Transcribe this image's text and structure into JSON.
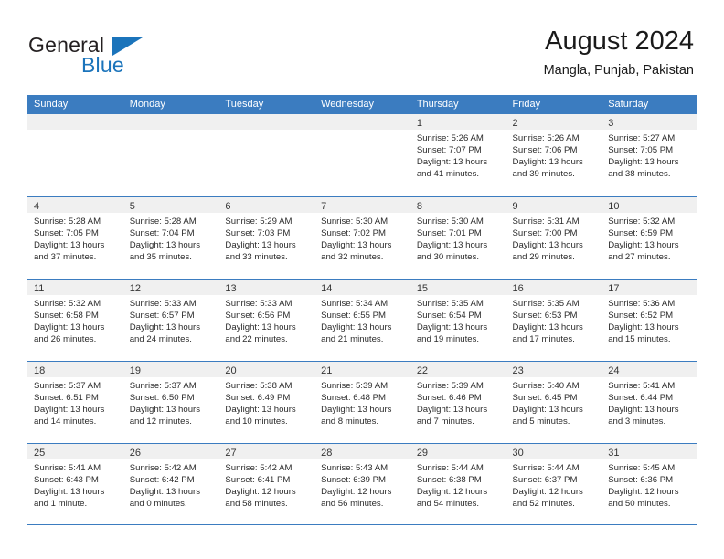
{
  "brand": {
    "name_part1": "General",
    "name_part2": "Blue",
    "triangle_icon": "triangle-icon",
    "accent_color": "#1b74bb"
  },
  "header": {
    "title": "August 2024",
    "location": "Mangla, Punjab, Pakistan"
  },
  "theme": {
    "header_blue": "#3b7cc0",
    "daynum_band": "#f0f0f0",
    "text": "#2b2b2b"
  },
  "weekdays": [
    "Sunday",
    "Monday",
    "Tuesday",
    "Wednesday",
    "Thursday",
    "Friday",
    "Saturday"
  ],
  "labels": {
    "sunrise": "Sunrise:",
    "sunset": "Sunset:",
    "daylight": "Daylight:"
  },
  "weeks": [
    [
      {
        "day": "",
        "empty": true
      },
      {
        "day": "",
        "empty": true
      },
      {
        "day": "",
        "empty": true
      },
      {
        "day": "",
        "empty": true
      },
      {
        "day": "1",
        "sunrise": "Sunrise: 5:26 AM",
        "sunset": "Sunset: 7:07 PM",
        "daylight": "Daylight: 13 hours and 41 minutes."
      },
      {
        "day": "2",
        "sunrise": "Sunrise: 5:26 AM",
        "sunset": "Sunset: 7:06 PM",
        "daylight": "Daylight: 13 hours and 39 minutes."
      },
      {
        "day": "3",
        "sunrise": "Sunrise: 5:27 AM",
        "sunset": "Sunset: 7:05 PM",
        "daylight": "Daylight: 13 hours and 38 minutes."
      }
    ],
    [
      {
        "day": "4",
        "sunrise": "Sunrise: 5:28 AM",
        "sunset": "Sunset: 7:05 PM",
        "daylight": "Daylight: 13 hours and 37 minutes."
      },
      {
        "day": "5",
        "sunrise": "Sunrise: 5:28 AM",
        "sunset": "Sunset: 7:04 PM",
        "daylight": "Daylight: 13 hours and 35 minutes."
      },
      {
        "day": "6",
        "sunrise": "Sunrise: 5:29 AM",
        "sunset": "Sunset: 7:03 PM",
        "daylight": "Daylight: 13 hours and 33 minutes."
      },
      {
        "day": "7",
        "sunrise": "Sunrise: 5:30 AM",
        "sunset": "Sunset: 7:02 PM",
        "daylight": "Daylight: 13 hours and 32 minutes."
      },
      {
        "day": "8",
        "sunrise": "Sunrise: 5:30 AM",
        "sunset": "Sunset: 7:01 PM",
        "daylight": "Daylight: 13 hours and 30 minutes."
      },
      {
        "day": "9",
        "sunrise": "Sunrise: 5:31 AM",
        "sunset": "Sunset: 7:00 PM",
        "daylight": "Daylight: 13 hours and 29 minutes."
      },
      {
        "day": "10",
        "sunrise": "Sunrise: 5:32 AM",
        "sunset": "Sunset: 6:59 PM",
        "daylight": "Daylight: 13 hours and 27 minutes."
      }
    ],
    [
      {
        "day": "11",
        "sunrise": "Sunrise: 5:32 AM",
        "sunset": "Sunset: 6:58 PM",
        "daylight": "Daylight: 13 hours and 26 minutes."
      },
      {
        "day": "12",
        "sunrise": "Sunrise: 5:33 AM",
        "sunset": "Sunset: 6:57 PM",
        "daylight": "Daylight: 13 hours and 24 minutes."
      },
      {
        "day": "13",
        "sunrise": "Sunrise: 5:33 AM",
        "sunset": "Sunset: 6:56 PM",
        "daylight": "Daylight: 13 hours and 22 minutes."
      },
      {
        "day": "14",
        "sunrise": "Sunrise: 5:34 AM",
        "sunset": "Sunset: 6:55 PM",
        "daylight": "Daylight: 13 hours and 21 minutes."
      },
      {
        "day": "15",
        "sunrise": "Sunrise: 5:35 AM",
        "sunset": "Sunset: 6:54 PM",
        "daylight": "Daylight: 13 hours and 19 minutes."
      },
      {
        "day": "16",
        "sunrise": "Sunrise: 5:35 AM",
        "sunset": "Sunset: 6:53 PM",
        "daylight": "Daylight: 13 hours and 17 minutes."
      },
      {
        "day": "17",
        "sunrise": "Sunrise: 5:36 AM",
        "sunset": "Sunset: 6:52 PM",
        "daylight": "Daylight: 13 hours and 15 minutes."
      }
    ],
    [
      {
        "day": "18",
        "sunrise": "Sunrise: 5:37 AM",
        "sunset": "Sunset: 6:51 PM",
        "daylight": "Daylight: 13 hours and 14 minutes."
      },
      {
        "day": "19",
        "sunrise": "Sunrise: 5:37 AM",
        "sunset": "Sunset: 6:50 PM",
        "daylight": "Daylight: 13 hours and 12 minutes."
      },
      {
        "day": "20",
        "sunrise": "Sunrise: 5:38 AM",
        "sunset": "Sunset: 6:49 PM",
        "daylight": "Daylight: 13 hours and 10 minutes."
      },
      {
        "day": "21",
        "sunrise": "Sunrise: 5:39 AM",
        "sunset": "Sunset: 6:48 PM",
        "daylight": "Daylight: 13 hours and 8 minutes."
      },
      {
        "day": "22",
        "sunrise": "Sunrise: 5:39 AM",
        "sunset": "Sunset: 6:46 PM",
        "daylight": "Daylight: 13 hours and 7 minutes."
      },
      {
        "day": "23",
        "sunrise": "Sunrise: 5:40 AM",
        "sunset": "Sunset: 6:45 PM",
        "daylight": "Daylight: 13 hours and 5 minutes."
      },
      {
        "day": "24",
        "sunrise": "Sunrise: 5:41 AM",
        "sunset": "Sunset: 6:44 PM",
        "daylight": "Daylight: 13 hours and 3 minutes."
      }
    ],
    [
      {
        "day": "25",
        "sunrise": "Sunrise: 5:41 AM",
        "sunset": "Sunset: 6:43 PM",
        "daylight": "Daylight: 13 hours and 1 minute."
      },
      {
        "day": "26",
        "sunrise": "Sunrise: 5:42 AM",
        "sunset": "Sunset: 6:42 PM",
        "daylight": "Daylight: 13 hours and 0 minutes."
      },
      {
        "day": "27",
        "sunrise": "Sunrise: 5:42 AM",
        "sunset": "Sunset: 6:41 PM",
        "daylight": "Daylight: 12 hours and 58 minutes."
      },
      {
        "day": "28",
        "sunrise": "Sunrise: 5:43 AM",
        "sunset": "Sunset: 6:39 PM",
        "daylight": "Daylight: 12 hours and 56 minutes."
      },
      {
        "day": "29",
        "sunrise": "Sunrise: 5:44 AM",
        "sunset": "Sunset: 6:38 PM",
        "daylight": "Daylight: 12 hours and 54 minutes."
      },
      {
        "day": "30",
        "sunrise": "Sunrise: 5:44 AM",
        "sunset": "Sunset: 6:37 PM",
        "daylight": "Daylight: 12 hours and 52 minutes."
      },
      {
        "day": "31",
        "sunrise": "Sunrise: 5:45 AM",
        "sunset": "Sunset: 6:36 PM",
        "daylight": "Daylight: 12 hours and 50 minutes."
      }
    ]
  ]
}
